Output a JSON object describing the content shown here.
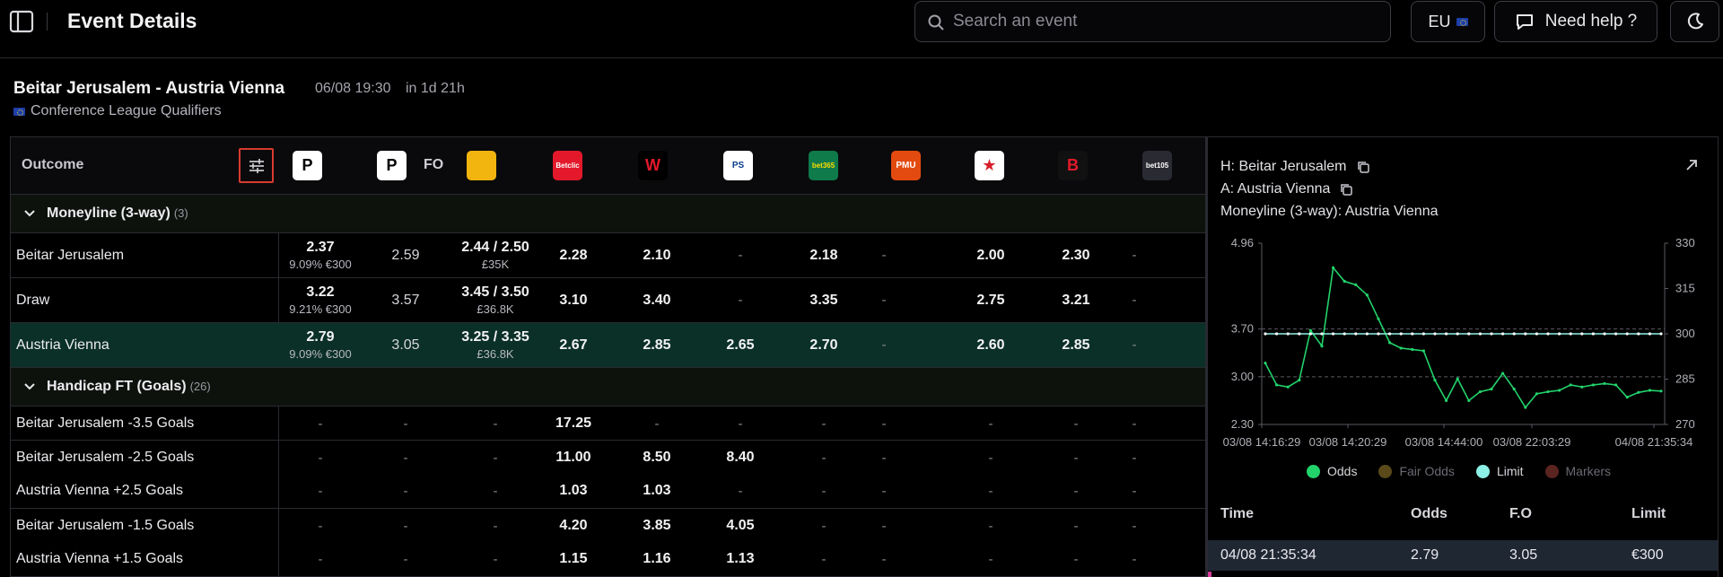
{
  "header": {
    "title": "Event Details",
    "search_placeholder": "Search an event",
    "region": "EU",
    "help_label": "Need help ?"
  },
  "event": {
    "name": "Beitar Jerusalem - Austria Vienna",
    "date": "06/08 19:30",
    "countdown": "in 1d 21h",
    "competition": "Conference League Qualifiers"
  },
  "table": {
    "outcome_header": "Outcome",
    "fo_label": "FO",
    "bookmakers": [
      {
        "name": "pinnacle",
        "glyph": "P",
        "bg": "#ffffff",
        "fg": "#000000"
      },
      {
        "name": "pinnacle-fo",
        "glyph": "P",
        "bg": "#ffffff",
        "fg": "#000000"
      },
      {
        "name": "coolbet",
        "glyph": "",
        "bg": "#f2b40f",
        "fg": "#000000"
      },
      {
        "name": "betclic",
        "glyph": "Betclic",
        "bg": "#e3192b",
        "fg": "#ffffff"
      },
      {
        "name": "winamax",
        "glyph": "W",
        "bg": "#000000",
        "fg": "#e3192b"
      },
      {
        "name": "parions-sport",
        "glyph": "PS",
        "bg": "#ffffff",
        "fg": "#0a3c8c"
      },
      {
        "name": "bet365",
        "glyph": "bet365",
        "bg": "#0f7a4a",
        "fg": "#ffde00"
      },
      {
        "name": "pmu",
        "glyph": "PMU",
        "bg": "#e34a0f",
        "fg": "#ffffff"
      },
      {
        "name": "pokerstars-sports",
        "glyph": "★",
        "bg": "#ffffff",
        "fg": "#d81e2b"
      },
      {
        "name": "betonline",
        "glyph": "B",
        "bg": "#111111",
        "fg": "#e3192b"
      },
      {
        "name": "bet105",
        "glyph": "bet105",
        "bg": "#2a2a32",
        "fg": "#ffffff"
      }
    ],
    "moneyline": {
      "title": "Moneyline (3-way)",
      "count": "(3)",
      "rows": [
        {
          "outcome": "Beitar Jerusalem",
          "highlight": false,
          "c1_main": "2.37",
          "c1_sub": "9.09%  €300",
          "c2": "2.59",
          "c3_main": "2.44 / 2.50",
          "c3_sub": "£35K",
          "c4": "2.28",
          "c5": "2.10",
          "c6": "-",
          "c7": "2.18",
          "c8": "-",
          "c9": "2.00",
          "c10": "2.30",
          "c11": "-"
        },
        {
          "outcome": "Draw",
          "highlight": false,
          "c1_main": "3.22",
          "c1_sub": "9.21%  €300",
          "c2": "3.57",
          "c3_main": "3.45 / 3.50",
          "c3_sub": "£36.8K",
          "c4": "3.10",
          "c5": "3.40",
          "c6": "-",
          "c7": "3.35",
          "c8": "-",
          "c9": "2.75",
          "c10": "3.21",
          "c11": "-"
        },
        {
          "outcome": "Austria Vienna",
          "highlight": true,
          "c1_main": "2.79",
          "c1_sub": "9.09%  €300",
          "c2": "3.05",
          "c3_main": "3.25 / 3.35",
          "c3_sub": "£36.8K",
          "c4": "2.67",
          "c5": "2.85",
          "c6": "2.65",
          "c7": "2.70",
          "c8": "-",
          "c9": "2.60",
          "c10": "2.85",
          "c11": "-"
        }
      ]
    },
    "handicap": {
      "title": "Handicap FT (Goals)",
      "count": "(26)",
      "rows": [
        {
          "outcome": "Beitar Jerusalem -3.5 Goals",
          "c1": "-",
          "c2": "-",
          "c3": "-",
          "c4": "17.25",
          "c5": "-",
          "c6": "-",
          "c7": "-",
          "c8": "-",
          "c9": "-",
          "c10": "-",
          "c11": "-"
        },
        {
          "outcome": "Beitar Jerusalem -2.5 Goals",
          "c1": "-",
          "c2": "-",
          "c3": "-",
          "c4": "11.00",
          "c5": "8.50",
          "c6": "8.40",
          "c7": "-",
          "c8": "-",
          "c9": "-",
          "c10": "-",
          "c11": "-"
        },
        {
          "outcome": "Austria Vienna +2.5 Goals",
          "c1": "-",
          "c2": "-",
          "c3": "-",
          "c4": "1.03",
          "c5": "1.03",
          "c6": "-",
          "c7": "-",
          "c8": "-",
          "c9": "-",
          "c10": "-",
          "c11": "-"
        },
        {
          "outcome": "Beitar Jerusalem -1.5 Goals",
          "c1": "-",
          "c2": "-",
          "c3": "-",
          "c4": "4.20",
          "c5": "3.85",
          "c6": "4.05",
          "c7": "-",
          "c8": "-",
          "c9": "-",
          "c10": "-",
          "c11": "-"
        },
        {
          "outcome": "Austria Vienna +1.5 Goals",
          "c1": "-",
          "c2": "-",
          "c3": "-",
          "c4": "1.15",
          "c5": "1.16",
          "c6": "1.13",
          "c7": "-",
          "c8": "-",
          "c9": "-",
          "c10": "-",
          "c11": "-"
        }
      ]
    }
  },
  "details": {
    "home": "H: Beitar Jerusalem",
    "away": "A: Austria Vienna",
    "market": "Moneyline (3-way): Austria Vienna",
    "legend": [
      {
        "label": "Odds",
        "color": "#22d36b",
        "active": true
      },
      {
        "label": "Fair Odds",
        "color": "#5a4a1a",
        "active": false
      },
      {
        "label": "Limit",
        "color": "#8df0e6",
        "active": true
      },
      {
        "label": "Markers",
        "color": "#5a2420",
        "active": false
      }
    ],
    "history_columns": [
      "Time",
      "Odds",
      "F.O",
      "Limit"
    ],
    "history_rows": [
      {
        "time": "04/08 21:35:34",
        "odds": "2.79",
        "fo": "3.05",
        "limit": "€300"
      }
    ]
  },
  "chart_data": {
    "type": "line",
    "x_ticks": [
      "03/08 14:16:29",
      "03/08 14:20:29",
      "03/08 14:44:00",
      "03/08 22:03:29",
      "04/08 21:35:34"
    ],
    "y_left_ticks": [
      "4.96",
      "3.70",
      "3.00",
      "2.30"
    ],
    "y_right_ticks": [
      "330",
      "315",
      "300",
      "285",
      "270"
    ],
    "y_left_range": [
      2.3,
      4.96
    ],
    "y_right_range": [
      270,
      330
    ],
    "series": [
      {
        "name": "Odds",
        "axis": "left",
        "color": "#22d36b",
        "values": [
          3.2,
          2.88,
          2.85,
          2.95,
          3.68,
          3.45,
          4.6,
          4.4,
          4.35,
          4.2,
          3.85,
          3.5,
          3.42,
          3.4,
          3.38,
          2.95,
          2.65,
          2.97,
          2.65,
          2.78,
          2.82,
          3.05,
          2.82,
          2.55,
          2.75,
          2.78,
          2.8,
          2.88,
          2.85,
          2.88,
          2.9,
          2.88,
          2.7,
          2.77,
          2.8,
          2.79
        ]
      },
      {
        "name": "Limit",
        "axis": "right",
        "color": "#8df0e6",
        "values": [
          300,
          300,
          300,
          300,
          300,
          300,
          300,
          300,
          300,
          300,
          300,
          300,
          300,
          300,
          300,
          300,
          300,
          300,
          300,
          300,
          300,
          300,
          300,
          300,
          300,
          300,
          300,
          300,
          300,
          300,
          300,
          300,
          300,
          300,
          300,
          300
        ]
      }
    ],
    "grid": true
  }
}
